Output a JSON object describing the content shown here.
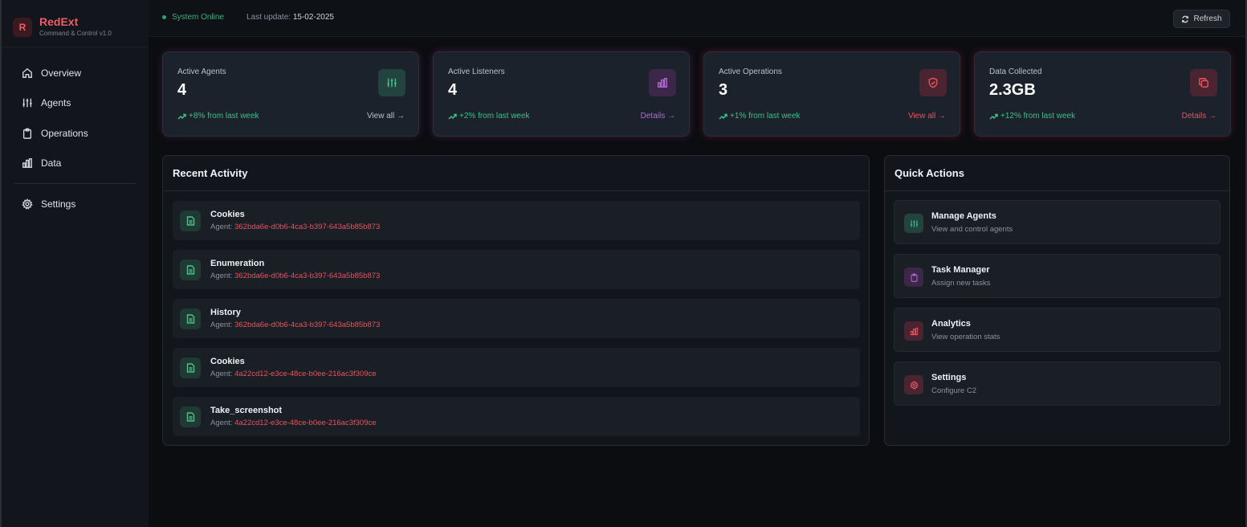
{
  "brand": {
    "logo_letter": "R",
    "name": "RedExt",
    "subtitle": "Command & Control v1.0"
  },
  "nav": {
    "items": [
      {
        "label": "Overview",
        "icon": "home-icon"
      },
      {
        "label": "Agents",
        "icon": "sliders-icon"
      },
      {
        "label": "Operations",
        "icon": "clipboard-icon"
      },
      {
        "label": "Data",
        "icon": "bar-chart-icon"
      }
    ],
    "settings": {
      "label": "Settings",
      "icon": "gear-icon"
    }
  },
  "topbar": {
    "status": "System Online",
    "update_label": "Last update:",
    "update_value": "15-02-2025",
    "refresh_label": "Refresh"
  },
  "stats": [
    {
      "title": "Active Agents",
      "value": "4",
      "trend": "+8% from last week",
      "link": "View all →",
      "icon": "sliders-icon",
      "accent": "#45c48e"
    },
    {
      "title": "Active Listeners",
      "value": "4",
      "trend": "+2% from last week",
      "link": "Details →",
      "icon": "bar-chart-icon",
      "accent": "#b06ad6"
    },
    {
      "title": "Active Operations",
      "value": "3",
      "trend": "+1% from last week",
      "link": "View all →",
      "icon": "shield-check-icon",
      "accent": "#e5535f"
    },
    {
      "title": "Data Collected",
      "value": "2.3GB",
      "trend": "+12% from last week",
      "link": "Details →",
      "icon": "copy-icon",
      "accent": "#e5535f"
    }
  ],
  "recent_activity": {
    "title": "Recent Activity",
    "agent_prefix": "Agent: ",
    "items": [
      {
        "title": "Cookies",
        "agent": "362bda6e-d0b6-4ca3-b397-643a5b85b873"
      },
      {
        "title": "Enumeration",
        "agent": "362bda6e-d0b6-4ca3-b397-643a5b85b873"
      },
      {
        "title": "History",
        "agent": "362bda6e-d0b6-4ca3-b397-643a5b85b873"
      },
      {
        "title": "Cookies",
        "agent": "4a22cd12-e3ce-48ce-b0ee-216ac3f309ce"
      },
      {
        "title": "Take_screenshot",
        "agent": "4a22cd12-e3ce-48ce-b0ee-216ac3f309ce"
      }
    ]
  },
  "quick_actions": {
    "title": "Quick Actions",
    "items": [
      {
        "title": "Manage Agents",
        "subtitle": "View and control agents",
        "icon": "sliders-icon"
      },
      {
        "title": "Task Manager",
        "subtitle": "Assign new tasks",
        "icon": "clipboard-icon"
      },
      {
        "title": "Analytics",
        "subtitle": "View operation stats",
        "icon": "bar-chart-icon"
      },
      {
        "title": "Settings",
        "subtitle": "Configure C2",
        "icon": "gear-icon"
      }
    ]
  }
}
